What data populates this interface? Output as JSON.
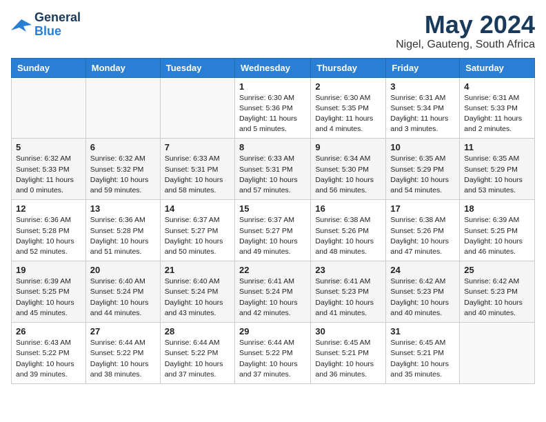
{
  "logo": {
    "line1": "General",
    "line2": "Blue"
  },
  "title": "May 2024",
  "location": "Nigel, Gauteng, South Africa",
  "days_of_week": [
    "Sunday",
    "Monday",
    "Tuesday",
    "Wednesday",
    "Thursday",
    "Friday",
    "Saturday"
  ],
  "weeks": [
    [
      {
        "day": "",
        "info": ""
      },
      {
        "day": "",
        "info": ""
      },
      {
        "day": "",
        "info": ""
      },
      {
        "day": "1",
        "info": "Sunrise: 6:30 AM\nSunset: 5:36 PM\nDaylight: 11 hours\nand 5 minutes."
      },
      {
        "day": "2",
        "info": "Sunrise: 6:30 AM\nSunset: 5:35 PM\nDaylight: 11 hours\nand 4 minutes."
      },
      {
        "day": "3",
        "info": "Sunrise: 6:31 AM\nSunset: 5:34 PM\nDaylight: 11 hours\nand 3 minutes."
      },
      {
        "day": "4",
        "info": "Sunrise: 6:31 AM\nSunset: 5:33 PM\nDaylight: 11 hours\nand 2 minutes."
      }
    ],
    [
      {
        "day": "5",
        "info": "Sunrise: 6:32 AM\nSunset: 5:33 PM\nDaylight: 11 hours\nand 0 minutes."
      },
      {
        "day": "6",
        "info": "Sunrise: 6:32 AM\nSunset: 5:32 PM\nDaylight: 10 hours\nand 59 minutes."
      },
      {
        "day": "7",
        "info": "Sunrise: 6:33 AM\nSunset: 5:31 PM\nDaylight: 10 hours\nand 58 minutes."
      },
      {
        "day": "8",
        "info": "Sunrise: 6:33 AM\nSunset: 5:31 PM\nDaylight: 10 hours\nand 57 minutes."
      },
      {
        "day": "9",
        "info": "Sunrise: 6:34 AM\nSunset: 5:30 PM\nDaylight: 10 hours\nand 56 minutes."
      },
      {
        "day": "10",
        "info": "Sunrise: 6:35 AM\nSunset: 5:29 PM\nDaylight: 10 hours\nand 54 minutes."
      },
      {
        "day": "11",
        "info": "Sunrise: 6:35 AM\nSunset: 5:29 PM\nDaylight: 10 hours\nand 53 minutes."
      }
    ],
    [
      {
        "day": "12",
        "info": "Sunrise: 6:36 AM\nSunset: 5:28 PM\nDaylight: 10 hours\nand 52 minutes."
      },
      {
        "day": "13",
        "info": "Sunrise: 6:36 AM\nSunset: 5:28 PM\nDaylight: 10 hours\nand 51 minutes."
      },
      {
        "day": "14",
        "info": "Sunrise: 6:37 AM\nSunset: 5:27 PM\nDaylight: 10 hours\nand 50 minutes."
      },
      {
        "day": "15",
        "info": "Sunrise: 6:37 AM\nSunset: 5:27 PM\nDaylight: 10 hours\nand 49 minutes."
      },
      {
        "day": "16",
        "info": "Sunrise: 6:38 AM\nSunset: 5:26 PM\nDaylight: 10 hours\nand 48 minutes."
      },
      {
        "day": "17",
        "info": "Sunrise: 6:38 AM\nSunset: 5:26 PM\nDaylight: 10 hours\nand 47 minutes."
      },
      {
        "day": "18",
        "info": "Sunrise: 6:39 AM\nSunset: 5:25 PM\nDaylight: 10 hours\nand 46 minutes."
      }
    ],
    [
      {
        "day": "19",
        "info": "Sunrise: 6:39 AM\nSunset: 5:25 PM\nDaylight: 10 hours\nand 45 minutes."
      },
      {
        "day": "20",
        "info": "Sunrise: 6:40 AM\nSunset: 5:24 PM\nDaylight: 10 hours\nand 44 minutes."
      },
      {
        "day": "21",
        "info": "Sunrise: 6:40 AM\nSunset: 5:24 PM\nDaylight: 10 hours\nand 43 minutes."
      },
      {
        "day": "22",
        "info": "Sunrise: 6:41 AM\nSunset: 5:24 PM\nDaylight: 10 hours\nand 42 minutes."
      },
      {
        "day": "23",
        "info": "Sunrise: 6:41 AM\nSunset: 5:23 PM\nDaylight: 10 hours\nand 41 minutes."
      },
      {
        "day": "24",
        "info": "Sunrise: 6:42 AM\nSunset: 5:23 PM\nDaylight: 10 hours\nand 40 minutes."
      },
      {
        "day": "25",
        "info": "Sunrise: 6:42 AM\nSunset: 5:23 PM\nDaylight: 10 hours\nand 40 minutes."
      }
    ],
    [
      {
        "day": "26",
        "info": "Sunrise: 6:43 AM\nSunset: 5:22 PM\nDaylight: 10 hours\nand 39 minutes."
      },
      {
        "day": "27",
        "info": "Sunrise: 6:44 AM\nSunset: 5:22 PM\nDaylight: 10 hours\nand 38 minutes."
      },
      {
        "day": "28",
        "info": "Sunrise: 6:44 AM\nSunset: 5:22 PM\nDaylight: 10 hours\nand 37 minutes."
      },
      {
        "day": "29",
        "info": "Sunrise: 6:44 AM\nSunset: 5:22 PM\nDaylight: 10 hours\nand 37 minutes."
      },
      {
        "day": "30",
        "info": "Sunrise: 6:45 AM\nSunset: 5:21 PM\nDaylight: 10 hours\nand 36 minutes."
      },
      {
        "day": "31",
        "info": "Sunrise: 6:45 AM\nSunset: 5:21 PM\nDaylight: 10 hours\nand 35 minutes."
      },
      {
        "day": "",
        "info": ""
      }
    ]
  ]
}
